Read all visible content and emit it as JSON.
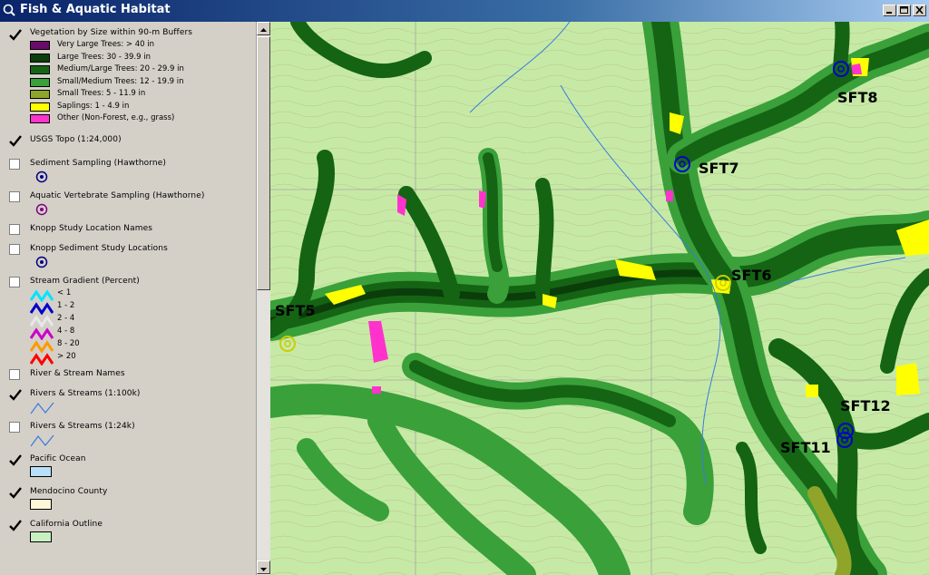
{
  "window": {
    "title": "Fish & Aquatic Habitat"
  },
  "toc": {
    "layers": [
      {
        "name": "Vegetation by Size within 90-m Buffers",
        "checked": true,
        "legend": [
          {
            "label": "Very Large Trees: > 40  in",
            "color": "#6a0a6a"
          },
          {
            "label": "Large Trees: 30 - 39.9 in",
            "color": "#0b3d0b"
          },
          {
            "label": "Medium/Large Trees: 20 - 29.9 in",
            "color": "#146414"
          },
          {
            "label": "Small/Medium Trees: 12 - 19.9 in",
            "color": "#3aa03a"
          },
          {
            "label": "Small Trees: 5 - 11.9 in",
            "color": "#8fa52a"
          },
          {
            "label": "Saplings: 1 - 4.9 in",
            "color": "#ffff00"
          },
          {
            "label": "Other (Non-Forest, e.g., grass)",
            "color": "#ff33cc"
          }
        ]
      },
      {
        "name": "USGS Topo (1:24,000)",
        "checked": true
      },
      {
        "name": "Sediment Sampling (Hawthorne)",
        "checked": false,
        "symbol_color": "#000080"
      },
      {
        "name": "Aquatic Vertebrate Sampling (Hawthorne)",
        "checked": false,
        "symbol_color": "#800080"
      },
      {
        "name": "Knopp Study Location Names",
        "checked": false
      },
      {
        "name": "Knopp Sediment Study Locations",
        "checked": false,
        "symbol_color": "#000080"
      },
      {
        "name": "Stream Gradient (Percent)",
        "checked": false,
        "legend": [
          {
            "label": "< 1",
            "color": "#00e5ff"
          },
          {
            "label": "1 - 2",
            "color": "#0000cc"
          },
          {
            "label": "2 - 4",
            "color": "#e0e0e0"
          },
          {
            "label": "4 - 8",
            "color": "#cc00cc"
          },
          {
            "label": "8 - 20",
            "color": "#ff9900"
          },
          {
            "label": "> 20",
            "color": "#ff0000"
          }
        ]
      },
      {
        "name": "River & Stream Names",
        "checked": false
      },
      {
        "name": "Rivers & Streams (1:100k)",
        "checked": true,
        "line_color": "#3a7ae0"
      },
      {
        "name": "Rivers & Streams (1:24k)",
        "checked": false,
        "line_color": "#3a7ae0"
      },
      {
        "name": "Pacific Ocean",
        "checked": true,
        "fill_color": "#b8e0f8"
      },
      {
        "name": "Mendocino County",
        "checked": true,
        "fill_color": "#fff8d8"
      },
      {
        "name": "California Outline",
        "checked": true,
        "fill_color": "#c8f0c0"
      }
    ]
  },
  "map": {
    "sites": [
      {
        "id": "SFT8",
        "label": "SFT8",
        "color": "#0000cc"
      },
      {
        "id": "SFT7",
        "label": "SFT7",
        "color": "#0000cc"
      },
      {
        "id": "SFT6",
        "label": "SFT6",
        "color": "#cccc00"
      },
      {
        "id": "SFT5",
        "label": "SFT5",
        "color": "#cccc00"
      },
      {
        "id": "SFT12",
        "label": "SFT12",
        "color": "#0000cc"
      },
      {
        "id": "SFT11",
        "label": "SFT11",
        "color": "#0000cc"
      }
    ]
  }
}
